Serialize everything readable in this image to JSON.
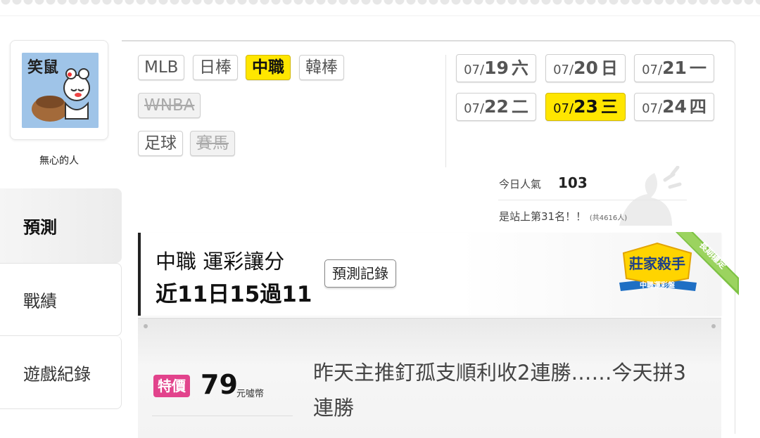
{
  "sidebar": {
    "username": "無心的人",
    "avatar_text": "笑鼠",
    "nav": [
      {
        "label": "預測",
        "active": true
      },
      {
        "label": "戰績",
        "active": false
      },
      {
        "label": "遊戲紀錄",
        "active": false
      }
    ]
  },
  "leagues": [
    {
      "label": "MLB",
      "state": "normal"
    },
    {
      "label": "日棒",
      "state": "normal"
    },
    {
      "label": "中職",
      "state": "active"
    },
    {
      "label": "韓棒",
      "state": "normal"
    },
    {
      "label": "WNBA",
      "state": "disabled"
    },
    {
      "label": "足球",
      "state": "normal"
    },
    {
      "label": "賽馬",
      "state": "disabled"
    }
  ],
  "dates": [
    {
      "md": "07/",
      "day": "19",
      "weekday": "六",
      "active": false
    },
    {
      "md": "07/",
      "day": "20",
      "weekday": "日",
      "active": false
    },
    {
      "md": "07/",
      "day": "21",
      "weekday": "一",
      "active": false
    },
    {
      "md": "07/",
      "day": "22",
      "weekday": "二",
      "active": false
    },
    {
      "md": "07/",
      "day": "23",
      "weekday": "三",
      "active": true
    },
    {
      "md": "07/",
      "day": "24",
      "weekday": "四",
      "active": false
    }
  ],
  "stats": {
    "popularity_label": "今日人氣",
    "popularity_value": "103",
    "rank_text": "是站上第31名！！",
    "rank_total": "(共4616人)"
  },
  "header_card": {
    "title": "中職 運彩讓分",
    "record": "近11日15過11",
    "history_button": "預測記錄",
    "badge_title": "莊家殺手",
    "badge_subtitle": "中職運彩盤",
    "badge_ribbon": "長期穩定"
  },
  "offer": {
    "tag": "特價",
    "price": "79",
    "price_unit": "元噓幣",
    "text": "昨天主推釘孤支順利收2連勝……今天拼3連勝"
  },
  "colors": {
    "active_yellow": "#ffe600",
    "tag_pink": "#e2438c"
  }
}
